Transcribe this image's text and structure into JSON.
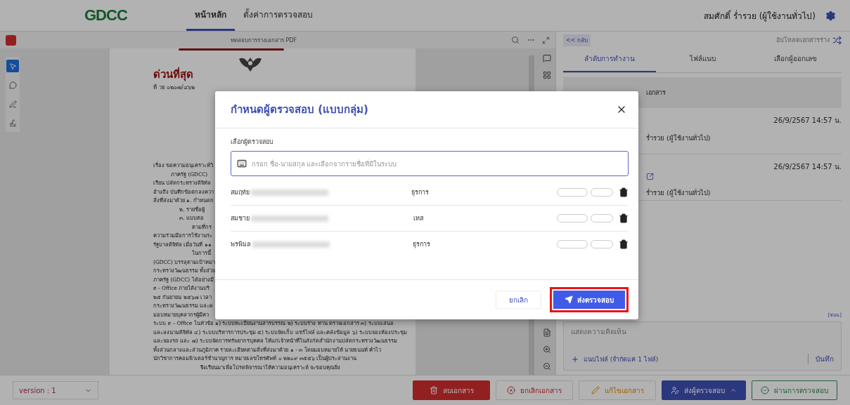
{
  "top_bar": {
    "logo": "GDCC",
    "tabs": [
      {
        "label": "หน้าหลัก",
        "selected": true
      },
      {
        "label": "ตั้งค่าการตรวจสอบ",
        "selected": false
      }
    ],
    "user": "สมศักดิ์ ร่ำรวย (ผู้ใช้งานทั่วไป)"
  },
  "viewer": {
    "title": "ทดสอบการร่างเอกสาร",
    "file_type": "PDF",
    "document": {
      "urgency": "ด่วนที่สุด",
      "ref": "ที่ วธ ๐๒๐๗/๔๖๒",
      "lines": [
        {
          "kind": "plain",
          "text": "เรื่อง  ขอความอนุเคราะห์วิ"
        },
        {
          "kind": "indent",
          "text": "ภาครัฐ (GDCC)"
        },
        {
          "kind": "plain",
          "text": "เรียน  ปลัดกระทรวงดิจิทัล"
        },
        {
          "kind": "plain",
          "text": "อ้างถึง  บันทึกข้อตกลงควา"
        },
        {
          "kind": "plain",
          "text": "สิ่งที่ส่งมาด้วย  ๑. กำหนดก"
        },
        {
          "kind": "list",
          "text": "๒. รายชื่อผู้"
        },
        {
          "kind": "list",
          "text": "๓. แบบตอ"
        },
        {
          "kind": "para",
          "text": "ตามที่กร"
        },
        {
          "kind": "plain",
          "text": "ความร่วมมือการใช้งานระ"
        },
        {
          "kind": "plain",
          "text": "รัฐบาลดิจิทัล เมื่อวันที่ ๑๑"
        },
        {
          "kind": "para",
          "text": "ในการนี้"
        },
        {
          "kind": "plain",
          "text": "(GDCC) บรรลุตามเป้าหมา"
        },
        {
          "kind": "plain",
          "text": "กระทรวงวัฒนธรรม ทั้งส่วน"
        },
        {
          "kind": "plain",
          "text": "ภาครัฐ (GDCC) ได้อย่างมี"
        },
        {
          "kind": "plain",
          "text": "e - Office ภายใต้งานบริ"
        },
        {
          "kind": "plain",
          "text": "๒๕ กันยายน ๒๕๖๗ เวลา"
        },
        {
          "kind": "plain",
          "text": "กระทรวงวัฒนธรรม และผ"
        },
        {
          "kind": "plain",
          "text": "มอบหมายบุคลากรผู้มีคว"
        },
        {
          "kind": "plain",
          "text": "ระบบ e – Office ในหัวข้อ ๑) ระบบทะเบียนงานสารบรรณ ๒) ระบบร่าง ทาน ตรวจเอกสาร ๓) ระบบเสนอ"
        },
        {
          "kind": "plain",
          "text": "และลงนามดิจิทัล ๔) ระบบบริหารการประชุม ๕) ระบบจัดเก็บ แชร์ไฟล์ และคลังข้อมูล ๖) ระบบจองห้องประชุม"
        },
        {
          "kind": "plain",
          "text": "และจองรถ และ ๗) ระบบจัดการทรัพยากรบุคคล ให้แก่เจ้าหน้าที่ในสังกัดสำนักงานปลัดกระทรวงวัฒนธรรม"
        },
        {
          "kind": "plain",
          "text": "ทั้งส่วนกลางและส่วนภูมิภาค รายละเอียดตามสิ่งที่ส่งมาด้วย ๑ - ๓ โดยมอบหมายให้ นายธนนท์ คำไว"
        },
        {
          "kind": "plain",
          "text": "นักวิชาการคอมพิวเตอร์ชำนาญการ หมายเลขโทรศัพท์ ๐ ๒๒๐๙ ๓๕๕๖ เป็นผู้ประสานงาน"
        },
        {
          "kind": "center",
          "text": "จึงเรียนมาเพื่อโปรดพิจารณาให้ความอนุเคราะห์ จะขอบคุณยิ่ง"
        }
      ]
    }
  },
  "side_panel": {
    "back_link": "<< กลับ",
    "upload_link": "อัปโหลดเอกสารร่าง",
    "tabs": [
      {
        "label": "ลำดับการทำงาน",
        "selected": true
      },
      {
        "label": "ไฟล์แนบ",
        "selected": false
      },
      {
        "label": "เลือกผู้ออกเลข",
        "selected": false
      }
    ],
    "subject": "เอกสาร",
    "entries": [
      {
        "date": "26/9/2567 14:57 น.",
        "user": "ร่ำรวย (ผู้ใช้งานทั่วไป)",
        "link": false
      },
      {
        "date": "26/9/2567 14:57 น.",
        "user": "ร่ำรวย (ผู้ใช้งานทั่วไป)",
        "link": true
      }
    ],
    "hide_link": "[ซ่อน]",
    "comment": {
      "placeholder": "แสดงความคิดเห็น",
      "attach": "แนบไฟล์ (จำกัดแค่ 1 ไฟล์)",
      "save": "บันทึก"
    }
  },
  "bottom_bar": {
    "version": "version : 1",
    "buttons": [
      {
        "kind": "danger",
        "label": "ลบเอกสาร"
      },
      {
        "kind": "cancel",
        "label": "ยกเลิกเอกสาร"
      },
      {
        "kind": "edit",
        "label": "แก้ไขเอกสาร"
      },
      {
        "kind": "send",
        "label": "ส่งผู้ตรวจสอบ"
      },
      {
        "kind": "approve",
        "label": "ผ่านการตรวจสอบ"
      }
    ]
  },
  "dialog": {
    "title": "กำหนดผู้ตรวจสอบ (แบบกลุ่ม)",
    "field_label": "เลือกผู้ตรวจสอบ",
    "placeholder": "กรอก ชื่อ-นามสกุล และเลือกจากรายชื่อที่มีในระบบ",
    "reviewers": [
      {
        "first_name": "สมฤทัย",
        "position": "ธุรการ"
      },
      {
        "first_name": "สมชาย",
        "position": "เทส"
      },
      {
        "first_name": "พรพิมล",
        "position": "ธุรการ"
      }
    ],
    "cancel": "ยกเลิก",
    "submit": {
      "label": "ส่งตรวจสอบ",
      "highlighted": true
    }
  }
}
